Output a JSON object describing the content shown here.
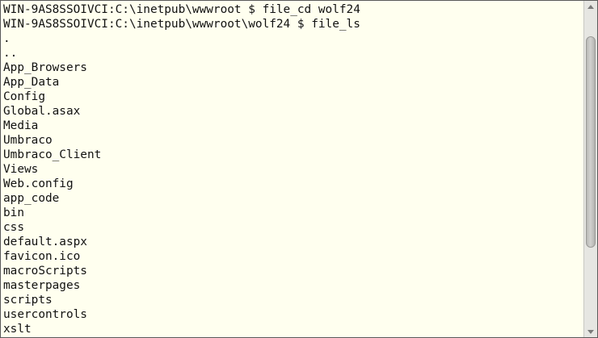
{
  "terminal": {
    "lines": [
      "WIN-9AS8SSOIVCI:C:\\inetpub\\wwwroot $ file_cd wolf24",
      "WIN-9AS8SSOIVCI:C:\\inetpub\\wwwroot\\wolf24 $ file_ls",
      ".",
      "..",
      "App_Browsers",
      "App_Data",
      "Config",
      "Global.asax",
      "Media",
      "Umbraco",
      "Umbraco_Client",
      "Views",
      "Web.config",
      "app_code",
      "bin",
      "css",
      "default.aspx",
      "favicon.ico",
      "macroScripts",
      "masterpages",
      "scripts",
      "usercontrols",
      "xslt"
    ]
  },
  "scrollbar": {
    "up_icon": "arrow-up-icon",
    "down_icon": "arrow-down-icon"
  }
}
